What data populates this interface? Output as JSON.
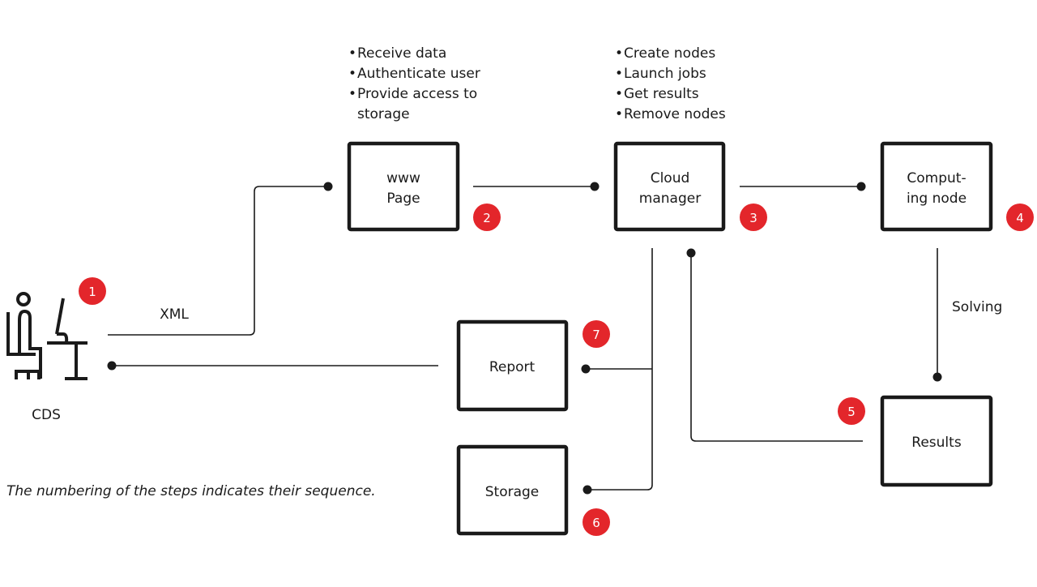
{
  "accent_color": "#e3262b",
  "cds": {
    "label": "CDS",
    "badge": "1",
    "icon": "person-at-computer-icon"
  },
  "xml_label": "XML",
  "www_page": {
    "lines": [
      "www",
      "Page"
    ],
    "badge": "2",
    "bullets": [
      "Receive data",
      "Authenticate user",
      "Provide access to",
      "storage"
    ]
  },
  "cloud_manager": {
    "lines": [
      "Cloud",
      "manager"
    ],
    "badge": "3",
    "bullets": [
      "Create nodes",
      "Launch jobs",
      "Get results",
      "Remove nodes"
    ]
  },
  "computing_node": {
    "lines": [
      "Comput-",
      "ing node"
    ],
    "badge": "4"
  },
  "solving_label": "Solving",
  "results": {
    "label": "Results",
    "badge": "5"
  },
  "storage": {
    "label": "Storage",
    "badge": "6"
  },
  "report": {
    "label": "Report",
    "badge": "7"
  },
  "note": "The numbering of the steps indicates their sequence."
}
